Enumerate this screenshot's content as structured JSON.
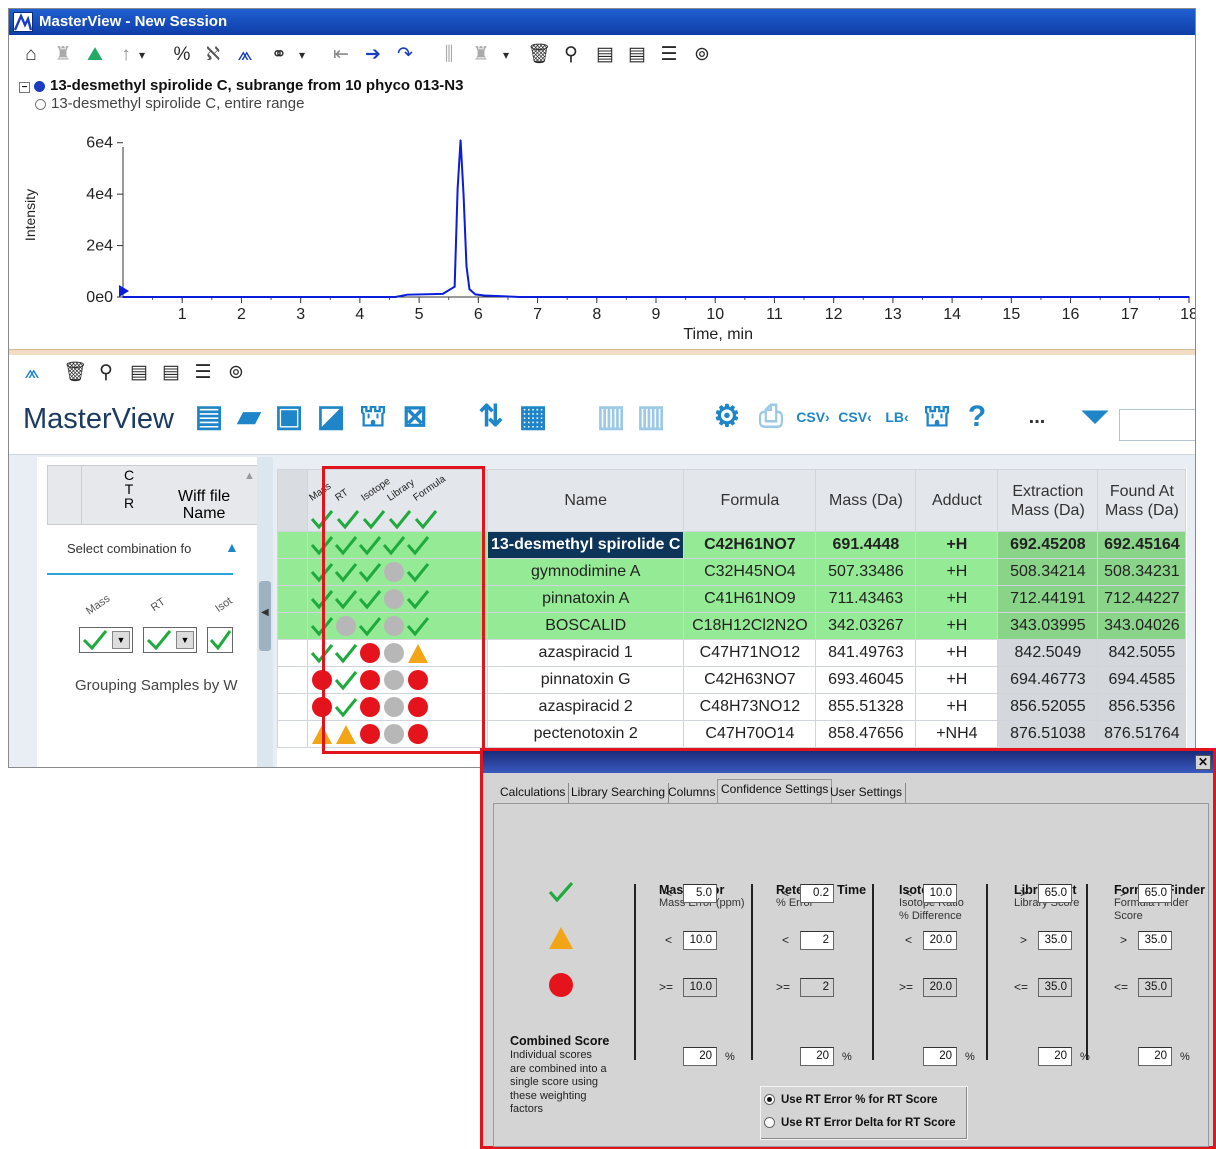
{
  "window": {
    "title": "MasterView - New Session"
  },
  "session": {
    "item1": "13-desmethyl spirolide C, subrange from 10 phyco 013-N3",
    "item2": "13-desmethyl spirolide C, entire range"
  },
  "chart_data": {
    "type": "line",
    "title": "",
    "xlabel": "Time, min",
    "ylabel": "Intensity",
    "xlim": [
      0,
      18
    ],
    "ylim": [
      0,
      70000
    ],
    "x_ticks": [
      "1",
      "2",
      "3",
      "4",
      "5",
      "6",
      "7",
      "8",
      "9",
      "10",
      "11",
      "12",
      "13",
      "14",
      "15",
      "16",
      "17",
      "18"
    ],
    "y_ticks": [
      "0e0",
      "2e4",
      "4e4",
      "6e4"
    ],
    "series": [
      {
        "x": [
          0.0,
          4.6,
          4.8,
          5.4,
          5.6,
          5.65,
          5.7,
          5.75,
          5.8,
          5.85,
          5.95,
          6.1,
          6.7,
          18.0
        ],
        "y": [
          0,
          0,
          900,
          1200,
          4000,
          42000,
          61000,
          40000,
          12000,
          3000,
          1000,
          600,
          0,
          0
        ]
      }
    ],
    "color": "#0a1cdc"
  },
  "masterview": {
    "title": "MasterView",
    "more": "...",
    "left": {
      "col_ctr": "C\nT\nR",
      "col_wiff": "Wiff file\nName",
      "combo": "Select combination fo",
      "filters": [
        "Mass",
        "RT",
        "Isot"
      ],
      "grouping": "Grouping Samples by W"
    },
    "table": {
      "indicator_headers": [
        "Mass",
        "RT",
        "Isotope",
        "Library",
        "Formula"
      ],
      "headers": [
        "Name",
        "Formula",
        "Mass (Da)",
        "Adduct",
        "Extraction\nMass (Da)",
        "Found At\nMass (Da)"
      ],
      "rows": [
        {
          "ind": [
            "check",
            "check",
            "check",
            "check",
            "check"
          ],
          "name": "13-desmethyl spirolide C",
          "formula": "C42H61NO7",
          "mass": "691.4448",
          "adduct": "+H",
          "ext": "692.45208",
          "found": "692.45164"
        },
        {
          "ind": [
            "check",
            "check",
            "check",
            "grey",
            "check"
          ],
          "name": "gymnodimine A",
          "formula": "C32H45NO4",
          "mass": "507.33486",
          "adduct": "+H",
          "ext": "508.34214",
          "found": "508.34231"
        },
        {
          "ind": [
            "check",
            "check",
            "check",
            "grey",
            "check"
          ],
          "name": "pinnatoxin A",
          "formula": "C41H61NO9",
          "mass": "711.43463",
          "adduct": "+H",
          "ext": "712.44191",
          "found": "712.44227"
        },
        {
          "ind": [
            "check",
            "grey",
            "check",
            "grey",
            "check"
          ],
          "name": "BOSCALID",
          "formula": "C18H12Cl2N2O",
          "mass": "342.03267",
          "adduct": "+H",
          "ext": "343.03995",
          "found": "343.04026"
        },
        {
          "ind": [
            "check",
            "check",
            "red",
            "grey",
            "tri"
          ],
          "name": "azaspiracid 1",
          "formula": "C47H71NO12",
          "mass": "841.49763",
          "adduct": "+H",
          "ext": "842.5049",
          "found": "842.5055"
        },
        {
          "ind": [
            "red",
            "check",
            "red",
            "grey",
            "red"
          ],
          "name": "pinnatoxin G",
          "formula": "C42H63NO7",
          "mass": "693.46045",
          "adduct": "+H",
          "ext": "694.46773",
          "found": "694.4585"
        },
        {
          "ind": [
            "red",
            "check",
            "red",
            "grey",
            "red"
          ],
          "name": "azaspiracid 2",
          "formula": "C48H73NO12",
          "mass": "855.51328",
          "adduct": "+H",
          "ext": "856.52055",
          "found": "856.5356"
        },
        {
          "ind": [
            "tri",
            "tri",
            "red",
            "grey",
            "red"
          ],
          "name": "pectenotoxin 2",
          "formula": "C47H70O14",
          "mass": "858.47656",
          "adduct": "+NH4",
          "ext": "876.51038",
          "found": "876.51764"
        }
      ]
    }
  },
  "dialog": {
    "tabs": [
      "Calculations",
      "Library Searching",
      "Columns",
      "Confidence Settings",
      "User Settings"
    ],
    "active_tab": "Confidence Settings",
    "columns": [
      {
        "title": "Mass Error",
        "sub": "Mass Error (ppm)",
        "green_op": "<",
        "green": "5.0",
        "yellow_op": "<",
        "yellow": "10.0",
        "red_op": ">=",
        "red": "10.0",
        "weight": "20"
      },
      {
        "title": "Retention Time",
        "sub": "% Error",
        "green_op": "<",
        "green": "0.2",
        "yellow_op": "<",
        "yellow": "2",
        "red_op": ">=",
        "red": "2",
        "weight": "20"
      },
      {
        "title": "Isotope",
        "sub": "Isotope Ratio\n% Difference",
        "green_op": "<",
        "green": "10.0",
        "yellow_op": "<",
        "yellow": "20.0",
        "red_op": ">=",
        "red": "20.0",
        "weight": "20"
      },
      {
        "title": "Library Hit",
        "sub": "Library Score",
        "green_op": ">",
        "green": "65.0",
        "yellow_op": ">",
        "yellow": "35.0",
        "red_op": "<=",
        "red": "35.0",
        "weight": "20"
      },
      {
        "title": "Formula Finder",
        "sub": "Formula Finder\nScore",
        "green_op": ">",
        "green": "65.0",
        "yellow_op": ">",
        "yellow": "35.0",
        "red_op": "<=",
        "red": "35.0",
        "weight": "20"
      }
    ],
    "combined": {
      "title": "Combined Score",
      "desc": "Individual scores\nare combined into a\nsingle score using\nthese weighting\nfactors",
      "unit": "%"
    },
    "radio1": "Use RT Error % for RT Score",
    "radio2": "Use RT Error Delta  for RT Score",
    "colors": {
      "green": "#1eaa3c",
      "yellow": "#f2a516",
      "red": "#e5141c"
    }
  }
}
